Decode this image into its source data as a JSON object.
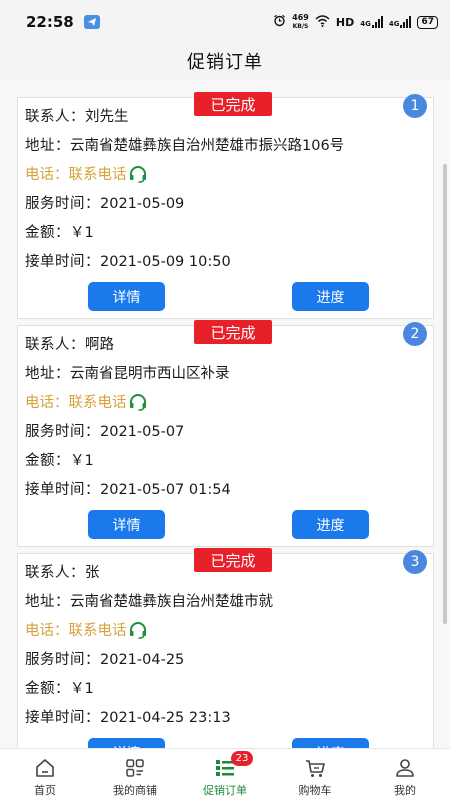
{
  "status_bar": {
    "time": "22:58",
    "speed_value": "469",
    "speed_unit": "KB/S",
    "hd_label": "HD",
    "net1": "4G",
    "net2": "4G",
    "battery": "67"
  },
  "header": {
    "title": "促销订单"
  },
  "labels": {
    "contact": "联系人：",
    "address": "地址：",
    "phone": "电话：联系电话",
    "service_time": "服务时间：",
    "amount": "金额：",
    "accept_time": "接单时间：",
    "detail_btn": "详情",
    "progress_btn": "进度"
  },
  "orders": [
    {
      "index": "1",
      "status": "已完成",
      "contact": "刘先生",
      "address": "云南省楚雄彝族自治州楚雄市振兴路106号",
      "service_time": "2021-05-09",
      "amount": "￥1",
      "accept_time": "2021-05-09 10:50"
    },
    {
      "index": "2",
      "status": "已完成",
      "contact": "啊路",
      "address": "云南省昆明市西山区补录",
      "service_time": "2021-05-07",
      "amount": "￥1",
      "accept_time": "2021-05-07 01:54"
    },
    {
      "index": "3",
      "status": "已完成",
      "contact": "张",
      "address": "云南省楚雄彝族自治州楚雄市就",
      "service_time": "2021-04-25",
      "amount": "￥1",
      "accept_time": "2021-04-25 23:13"
    }
  ],
  "tabbar": {
    "items": [
      {
        "label": "首页",
        "icon": "home-icon"
      },
      {
        "label": "我的商铺",
        "icon": "shop-grid-icon"
      },
      {
        "label": "促销订单",
        "icon": "promo-order-icon",
        "badge": "23"
      },
      {
        "label": "购物车",
        "icon": "cart-icon"
      },
      {
        "label": "我的",
        "icon": "user-icon"
      }
    ]
  },
  "colors": {
    "accent_blue": "#1a7aec",
    "status_red": "#e8202a",
    "phone_gold": "#d6a23a",
    "active_green": "#1d8a3a"
  }
}
